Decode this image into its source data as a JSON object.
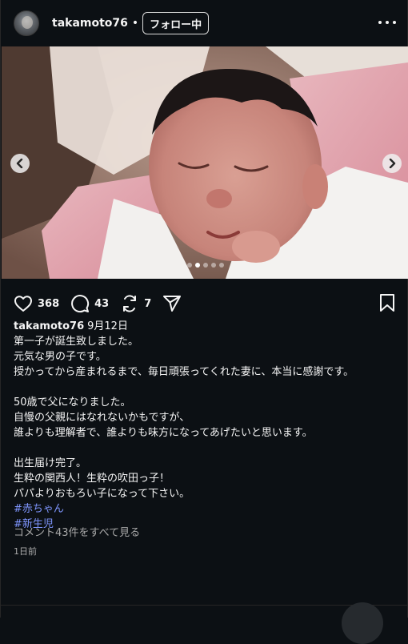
{
  "post": {
    "username": "takamoto76",
    "separator": "•",
    "follow_label": "フォロー中",
    "more_icon": "more-horizontal-icon",
    "photo": {
      "subject": "newborn-baby-photo",
      "carousel_count": 5,
      "carousel_active_index": 1
    },
    "actions": {
      "likes": "368",
      "comments": "43",
      "reposts": "7"
    },
    "caption": {
      "user": "takamoto76",
      "date": "9月12日",
      "lines": [
        "第一子が誕生致しました。",
        "元気な男の子です。",
        "授かってから産まれるまで、毎日頑張ってくれた妻に、本当に感謝です。",
        "",
        "50歳で父になりました。",
        "自慢の父親にはなれないかもですが、",
        "誰よりも理解者で、誰よりも味方になってあげたいと思います。",
        "",
        "出生届け完了。",
        "生粋の関西人！生粋の吹田っ子！",
        "パパよりおもろい子になって下さい。"
      ],
      "hashtags": [
        "#赤ちゃん",
        "#新生児"
      ]
    },
    "view_comments": "コメント43件をすべて見る",
    "time_ago": "1日前"
  },
  "colors": {
    "background": "#0c1014",
    "text": "#f5f5f5",
    "muted": "#a8a8a8",
    "hashtag": "#7f96ff"
  }
}
